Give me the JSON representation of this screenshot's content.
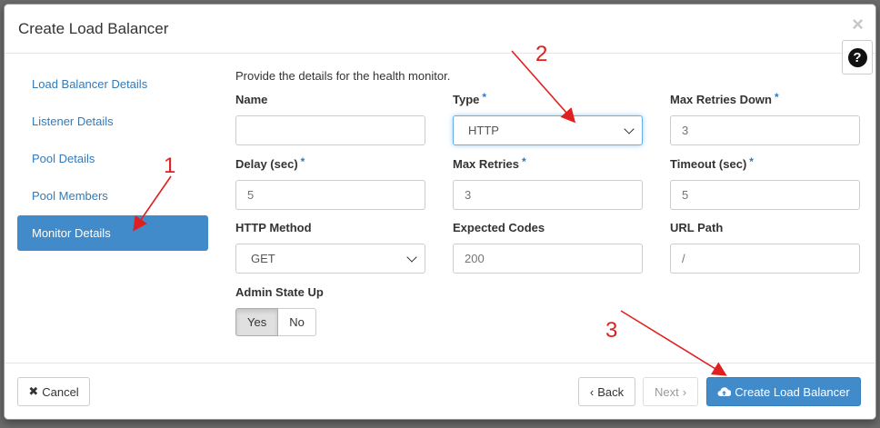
{
  "modal": {
    "title": "Create Load Balancer",
    "close_glyph": "×",
    "help_glyph": "?"
  },
  "side_nav": {
    "items": [
      {
        "label": "Load Balancer Details",
        "active": false
      },
      {
        "label": "Listener Details",
        "active": false
      },
      {
        "label": "Pool Details",
        "active": false
      },
      {
        "label": "Pool Members",
        "active": false
      },
      {
        "label": "Monitor Details",
        "active": true
      }
    ]
  },
  "form": {
    "intro": "Provide the details for the health monitor.",
    "required_mark": "*",
    "name": {
      "label": "Name",
      "value": "",
      "placeholder": ""
    },
    "type": {
      "label": "Type",
      "value": "HTTP"
    },
    "max_retries_down": {
      "label": "Max Retries Down",
      "placeholder": "3"
    },
    "delay": {
      "label": "Delay (sec)",
      "placeholder": "5"
    },
    "max_retries": {
      "label": "Max Retries",
      "placeholder": "3"
    },
    "timeout": {
      "label": "Timeout (sec)",
      "placeholder": "5"
    },
    "http_method": {
      "label": "HTTP Method",
      "value": "GET"
    },
    "expected_codes": {
      "label": "Expected Codes",
      "placeholder": "200"
    },
    "url_path": {
      "label": "URL Path",
      "placeholder": "/"
    },
    "admin_state": {
      "label": "Admin State Up",
      "yes": "Yes",
      "no": "No",
      "selected": "Yes"
    }
  },
  "footer": {
    "cancel": "Cancel",
    "back": "Back",
    "next": "Next",
    "create": "Create Load Balancer"
  },
  "annotations": {
    "one": "1",
    "two": "2",
    "three": "3",
    "color": "#e02020"
  },
  "colors": {
    "primary": "#428bca",
    "link": "#337ab7",
    "required": "#2d7bc4"
  },
  "icons": {
    "cancel": "close-icon",
    "back": "chevron-left-icon",
    "next": "chevron-right-icon",
    "create": "cloud-upload-icon",
    "help": "question-circle-icon"
  }
}
